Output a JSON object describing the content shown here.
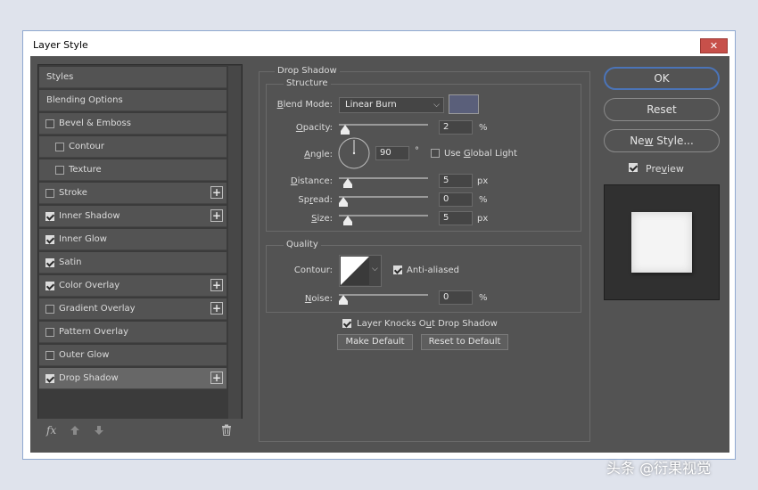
{
  "window": {
    "title": "Layer Style",
    "close_glyph": "✕"
  },
  "sidebar": {
    "items": [
      {
        "label": "Styles",
        "checkbox": false,
        "checked": false,
        "plus": false,
        "indent": false
      },
      {
        "label": "Blending Options",
        "checkbox": false,
        "checked": false,
        "plus": false,
        "indent": false
      },
      {
        "label": "Bevel & Emboss",
        "checkbox": true,
        "checked": false,
        "plus": false,
        "indent": false
      },
      {
        "label": "Contour",
        "checkbox": true,
        "checked": false,
        "plus": false,
        "indent": true
      },
      {
        "label": "Texture",
        "checkbox": true,
        "checked": false,
        "plus": false,
        "indent": true
      },
      {
        "label": "Stroke",
        "checkbox": true,
        "checked": false,
        "plus": true,
        "indent": false
      },
      {
        "label": "Inner Shadow",
        "checkbox": true,
        "checked": true,
        "plus": true,
        "indent": false
      },
      {
        "label": "Inner Glow",
        "checkbox": true,
        "checked": true,
        "plus": false,
        "indent": false
      },
      {
        "label": "Satin",
        "checkbox": true,
        "checked": true,
        "plus": false,
        "indent": false
      },
      {
        "label": "Color Overlay",
        "checkbox": true,
        "checked": true,
        "plus": true,
        "indent": false
      },
      {
        "label": "Gradient Overlay",
        "checkbox": true,
        "checked": false,
        "plus": true,
        "indent": false
      },
      {
        "label": "Pattern Overlay",
        "checkbox": true,
        "checked": false,
        "plus": false,
        "indent": false
      },
      {
        "label": "Outer Glow",
        "checkbox": true,
        "checked": false,
        "plus": false,
        "indent": false
      },
      {
        "label": "Drop Shadow",
        "checkbox": true,
        "checked": true,
        "plus": true,
        "indent": false,
        "selected": true
      }
    ],
    "footer": {
      "fx_label": "fx",
      "up_icon": "arrow-up-icon",
      "down_icon": "arrow-down-icon",
      "trash_icon": "trash-icon"
    }
  },
  "drop_shadow": {
    "section_title": "Drop Shadow",
    "structure_title": "Structure",
    "blend_mode": {
      "label_first": "B",
      "label_rest": "lend Mode:",
      "value": "Linear Burn",
      "color": "#5a5f7a"
    },
    "opacity": {
      "label_first": "O",
      "label_rest": "pacity:",
      "value": "2",
      "unit": "%",
      "fraction": 0.02
    },
    "angle": {
      "label_first": "A",
      "label_rest": "ngle:",
      "value": "90",
      "unit": "°",
      "global_light_label_pre": "Use ",
      "global_light_label_u": "G",
      "global_light_label_post": "lobal Light",
      "global_light_checked": false
    },
    "distance": {
      "label_first": "D",
      "label_rest": "istance:",
      "value": "5",
      "unit": "px",
      "fraction": 0.05
    },
    "spread": {
      "label_pre": "Sp",
      "label_u": "r",
      "label_post": "ead:",
      "value": "0",
      "unit": "%",
      "fraction": 0.0
    },
    "size": {
      "label_first": "S",
      "label_rest": "ize:",
      "value": "5",
      "unit": "px",
      "fraction": 0.05
    },
    "quality_title": "Quality",
    "contour_label": "Contour:",
    "anti_aliased_label": "Anti-aliased",
    "anti_aliased_checked": true,
    "noise": {
      "label_first": "N",
      "label_rest": "oise:",
      "value": "0",
      "unit": "%",
      "fraction": 0.0
    },
    "knockout_label_pre": "Layer Knocks O",
    "knockout_label_u": "u",
    "knockout_label_post": "t Drop Shadow",
    "knockout_checked": true,
    "make_default_label": "Make Default",
    "reset_default_label": "Reset to Default"
  },
  "actions": {
    "ok_label": "OK",
    "reset_label": "Reset",
    "new_style_label_pre": "Ne",
    "new_style_label_u": "w",
    "new_style_label_post": " Style...",
    "preview_label_pre": "Pre",
    "preview_label_u": "v",
    "preview_label_post": "iew",
    "preview_checked": true
  },
  "watermark": "头条 @衍果视觉"
}
